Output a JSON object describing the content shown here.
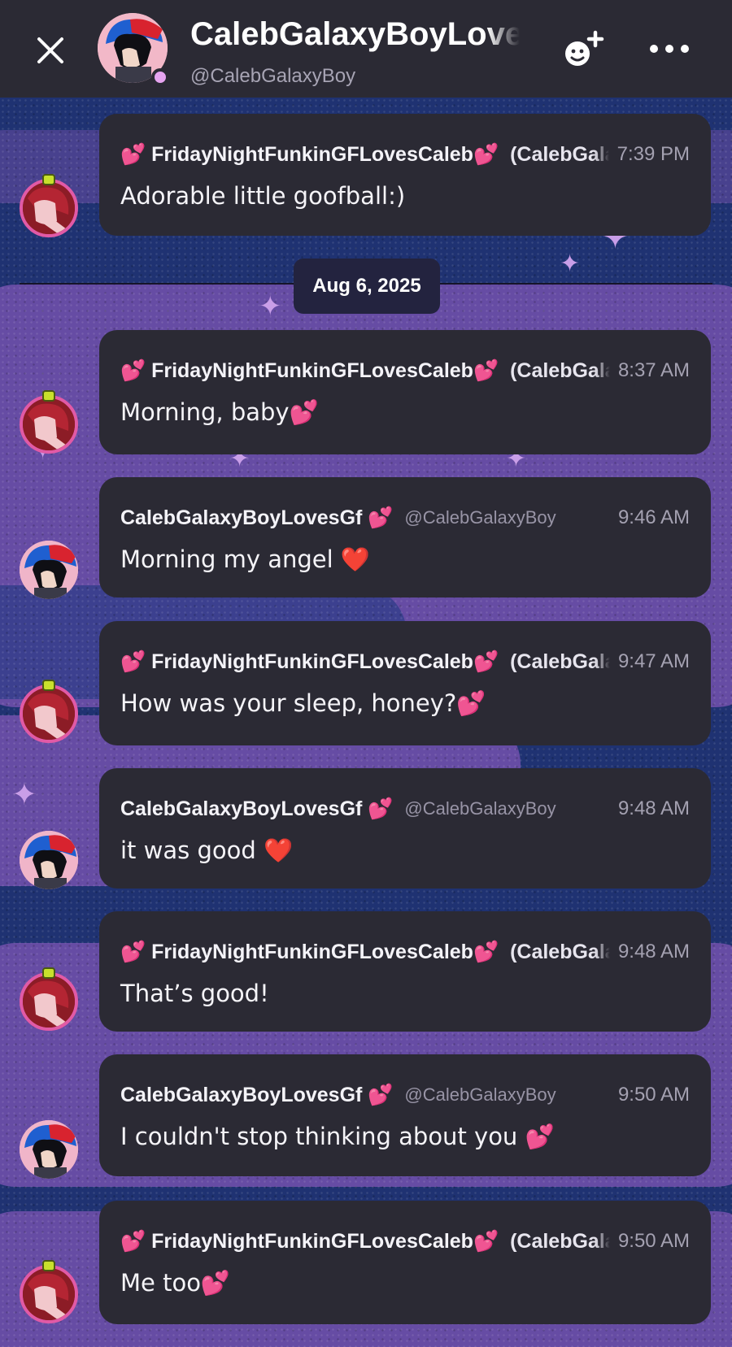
{
  "header": {
    "title": "CalebGalaxyBoyLovesGf",
    "subtitle": "@CalebGalaxyBoy"
  },
  "divider": {
    "date": "Aug 6, 2025"
  },
  "icons": {
    "close": "close-icon",
    "add_friend": "add-friend-icon",
    "more": "more-icon",
    "heart": "sparkling-heart-emoji",
    "red_heart": "two-hearts-emoji",
    "sparkle": "four-point-star"
  },
  "colors": {
    "header_bg": "#2b2a34",
    "card_bg": "#2b2a34",
    "galaxy_blue": "#1f3272",
    "galaxy_purple": "#6a4ea6",
    "emoji_pink": "#ff5cc8"
  },
  "messages": [
    {
      "author": "💕 FridayNightFunkinGFLovesCaleb💕",
      "tag": "(CalebGalaxyGirl)",
      "time": "7:39 PM",
      "text": "Adorable little goofball:)",
      "avatar": "gf"
    },
    {
      "author": "💕 FridayNightFunkinGFLovesCaleb💕",
      "tag": "(CalebGalaxyGirl)",
      "time": "8:37 AM",
      "text": "Morning, baby💕",
      "avatar": "gf"
    },
    {
      "author": "CalebGalaxyBoyLovesGf 💕",
      "tag": "@CalebGalaxyBoy",
      "time": "9:46 AM",
      "text": "Morning my angel ❤️",
      "avatar": "bf"
    },
    {
      "author": "💕 FridayNightFunkinGFLovesCaleb💕",
      "tag": "(CalebGalaxyGirl)",
      "time": "9:47 AM",
      "text": "How was your sleep, honey?💕",
      "avatar": "gf"
    },
    {
      "author": "CalebGalaxyBoyLovesGf 💕",
      "tag": "@CalebGalaxyBoy",
      "time": "9:48 AM",
      "text": "it was good ❤️",
      "avatar": "bf"
    },
    {
      "author": "💕 FridayNightFunkinGFLovesCaleb💕",
      "tag": "(CalebGalaxyGirl)",
      "time": "9:48 AM",
      "text": "That’s good!",
      "avatar": "gf"
    },
    {
      "author": "CalebGalaxyBoyLovesGf 💕",
      "tag": "@CalebGalaxyBoy",
      "time": "9:50 AM",
      "text": "I couldn't stop thinking about you 💕",
      "avatar": "bf"
    },
    {
      "author": "💕 FridayNightFunkinGFLovesCaleb💕",
      "tag": "(CalebGalaxyGirl)",
      "time": "9:50 AM",
      "text": "Me too💕",
      "avatar": "gf"
    }
  ]
}
